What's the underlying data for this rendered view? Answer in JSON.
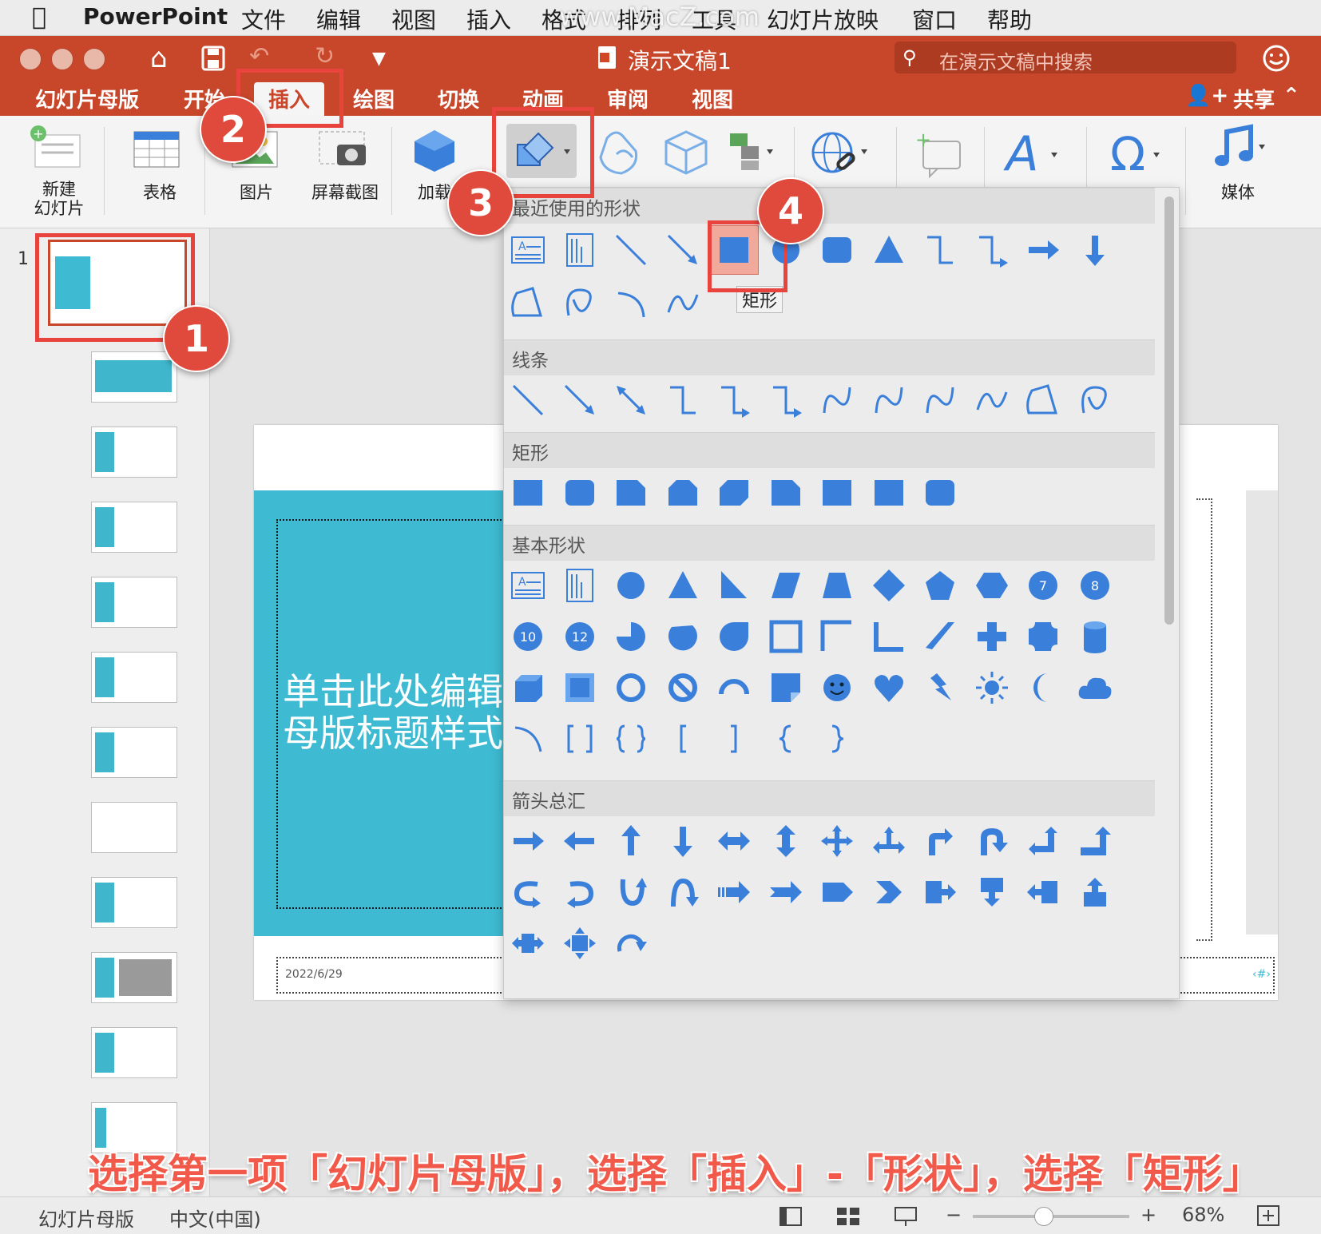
{
  "menubar": {
    "app": "PowerPoint",
    "items": [
      "文件",
      "编辑",
      "视图",
      "插入",
      "格式",
      "排列",
      "工具",
      "幻灯片放映",
      "窗口",
      "帮助"
    ],
    "watermark": "www.MacZ.com"
  },
  "titlebar": {
    "doc_title": "演示文稿1",
    "search_placeholder": "在演示文稿中搜索"
  },
  "tabs": {
    "items": [
      "幻灯片母版",
      "开始",
      "插入",
      "绘图",
      "切换",
      "动画",
      "审阅",
      "视图"
    ],
    "share": "共享"
  },
  "ribbon": {
    "new_slide": "新建\n幻灯片",
    "table": "表格",
    "picture": "图片",
    "screenshot": "屏幕截图",
    "addins": "加载",
    "media": "媒体"
  },
  "slide_panel": {
    "first_number": "1"
  },
  "slide": {
    "title": "单击此处编辑\n母版标题样式",
    "date": "2022/6/29",
    "page_marker": "‹#›"
  },
  "gallery": {
    "sections": [
      "最近使用的形状",
      "线条",
      "矩形",
      "基本形状",
      "箭头总汇"
    ],
    "tooltip": "矩形",
    "badges": [
      "7",
      "8",
      "10",
      "12"
    ]
  },
  "callouts": [
    "1",
    "2",
    "3",
    "4"
  ],
  "caption": "选择第一项「幻灯片母版」，选择「插入」-「形状」，选择「矩形」",
  "statusbar": {
    "view": "幻灯片母版",
    "language": "中文(中国)",
    "zoom": "68%",
    "zoom_level": 0.45
  },
  "colors": {
    "accent": "#c8472a",
    "shape_blue": "#3a7fd9",
    "slide_teal": "#3ebbd2",
    "callout_red": "#e04a3d"
  }
}
